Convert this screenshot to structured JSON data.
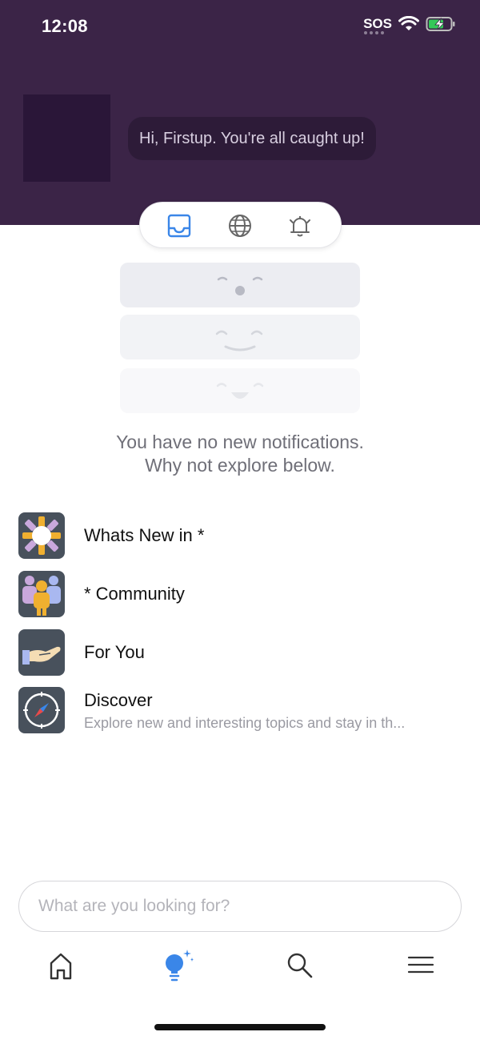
{
  "status_bar": {
    "time": "12:08",
    "sos_label": "SOS",
    "icons": [
      "wifi-icon",
      "battery-charging-icon"
    ]
  },
  "header": {
    "greeting": "Hi, Firstup. You're all caught up!",
    "background_color": "#3b2447"
  },
  "tabs": [
    {
      "name": "inbox",
      "icon": "inbox-icon",
      "active": true
    },
    {
      "name": "globe",
      "icon": "globe-icon",
      "active": false
    },
    {
      "name": "alerts",
      "icon": "bell-icon",
      "active": false
    }
  ],
  "empty_state": {
    "line1": "You have no new notifications.",
    "line2": "Why not explore below."
  },
  "channels": [
    {
      "title": "Whats New in *",
      "description": "",
      "icon": "sun-icon"
    },
    {
      "title": "* Community",
      "description": "",
      "icon": "people-icon"
    },
    {
      "title": "For You",
      "description": "",
      "icon": "hand-icon"
    },
    {
      "title": "Discover",
      "description": "Explore new and interesting topics and stay in th...",
      "icon": "compass-icon"
    }
  ],
  "search": {
    "placeholder": "What are you looking for?",
    "value": ""
  },
  "bottom_nav": [
    {
      "name": "home",
      "icon": "home-icon",
      "active": false
    },
    {
      "name": "ideas",
      "icon": "lightbulb-icon",
      "active": true
    },
    {
      "name": "search",
      "icon": "search-icon",
      "active": false
    },
    {
      "name": "menu",
      "icon": "menu-icon",
      "active": false
    }
  ],
  "colors": {
    "accent": "#3a86e8",
    "header": "#3b2447",
    "icon_tile": "#48515c"
  }
}
